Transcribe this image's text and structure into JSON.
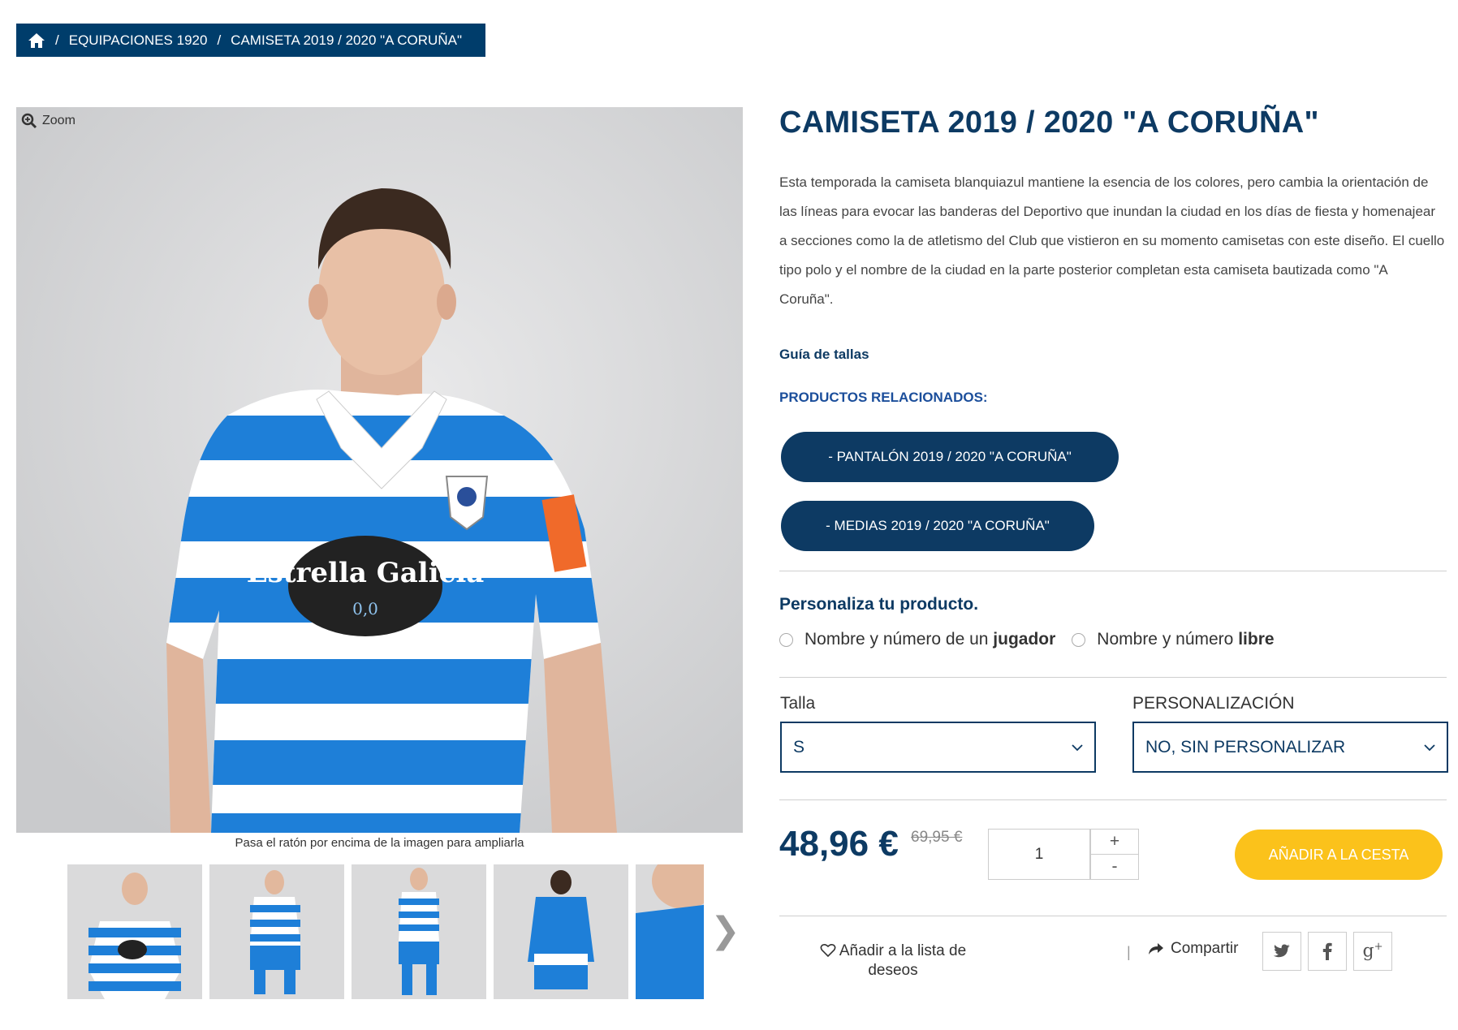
{
  "breadcrumb": {
    "home_icon": "home-icon",
    "items": [
      "EQUIPACIONES 1920",
      "CAMISETA 2019 / 2020 \"A CORUÑA\""
    ]
  },
  "gallery": {
    "zoom_label": "Zoom",
    "hint": "Pasa el ratón por encima de la imagen para ampliarla",
    "sponsor_text": "Estrella Galicia",
    "sponsor_sub": "0,0"
  },
  "product": {
    "title": "CAMISETA 2019 / 2020 \"A CORUÑA\"",
    "description": "Esta temporada la camiseta blanquiazul mantiene la esencia de los colores, pero cambia la orientación de las líneas para evocar las banderas del Deportivo que inundan la ciudad en los días de fiesta y homenajear a secciones como la de atletismo del Club que vistieron en su momento camisetas con este diseño. El cuello tipo polo y el nombre de la ciudad en la parte posterior completan esta camiseta bautizada como \"A Coruña\".",
    "size_guide": "Guía de tallas",
    "related_title": "PRODUCTOS RELACIONADOS:",
    "related": [
      "- PANTALÓN 2019 / 2020 \"A CORUÑA\"",
      "- MEDIAS 2019 / 2020 \"A CORUÑA\""
    ]
  },
  "personalize": {
    "title": "Personaliza tu producto.",
    "option1_prefix": "Nombre y número de un ",
    "option1_bold": "jugador",
    "option2_prefix": "Nombre y número ",
    "option2_bold": "libre"
  },
  "options": {
    "size_label": "Talla",
    "size_value": "S",
    "custom_label": "PERSONALIZACIÓN",
    "custom_value": "NO, SIN PERSONALIZAR"
  },
  "purchase": {
    "price": "48,96 €",
    "old_price": "69,95 €",
    "quantity": "1",
    "plus": "+",
    "minus": "-",
    "add_to_cart": "AÑADIR A LA CESTA"
  },
  "actions": {
    "wishlist": "Añadir a la lista de deseos",
    "share": "Compartir",
    "divider": "|"
  },
  "colors": {
    "brand_dark": "#0d3a63",
    "accent_yellow": "#fbc21b",
    "shirt_blue": "#1e7fd8"
  }
}
